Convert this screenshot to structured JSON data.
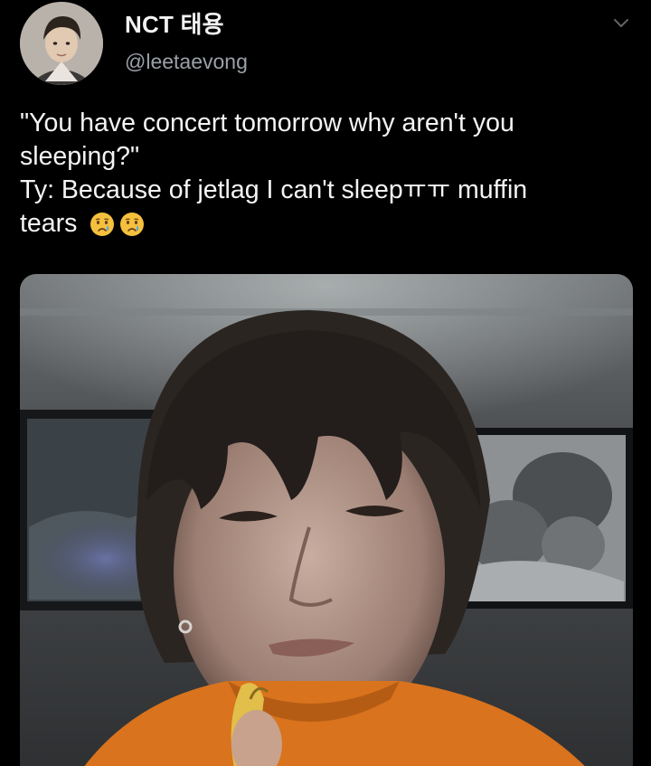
{
  "tweet": {
    "author": {
      "display_name": "NCT 태용",
      "handle": "@leetaevong",
      "avatar_icon": "profile-photo"
    },
    "menu_icon": "chevron-down-icon",
    "text_lines": [
      "\"You have concert tomorrow why aren't you",
      "sleeping?\"",
      "Ty: Because of jetlag I can't sleepㅠㅠ muffin",
      "tears"
    ],
    "emojis": [
      "crying-face-emoji",
      "crying-face-emoji"
    ],
    "media": {
      "kind": "photo"
    }
  },
  "colors": {
    "background": "#000000",
    "text_primary": "#f4f4f4",
    "text_secondary": "#9aa0a6"
  }
}
